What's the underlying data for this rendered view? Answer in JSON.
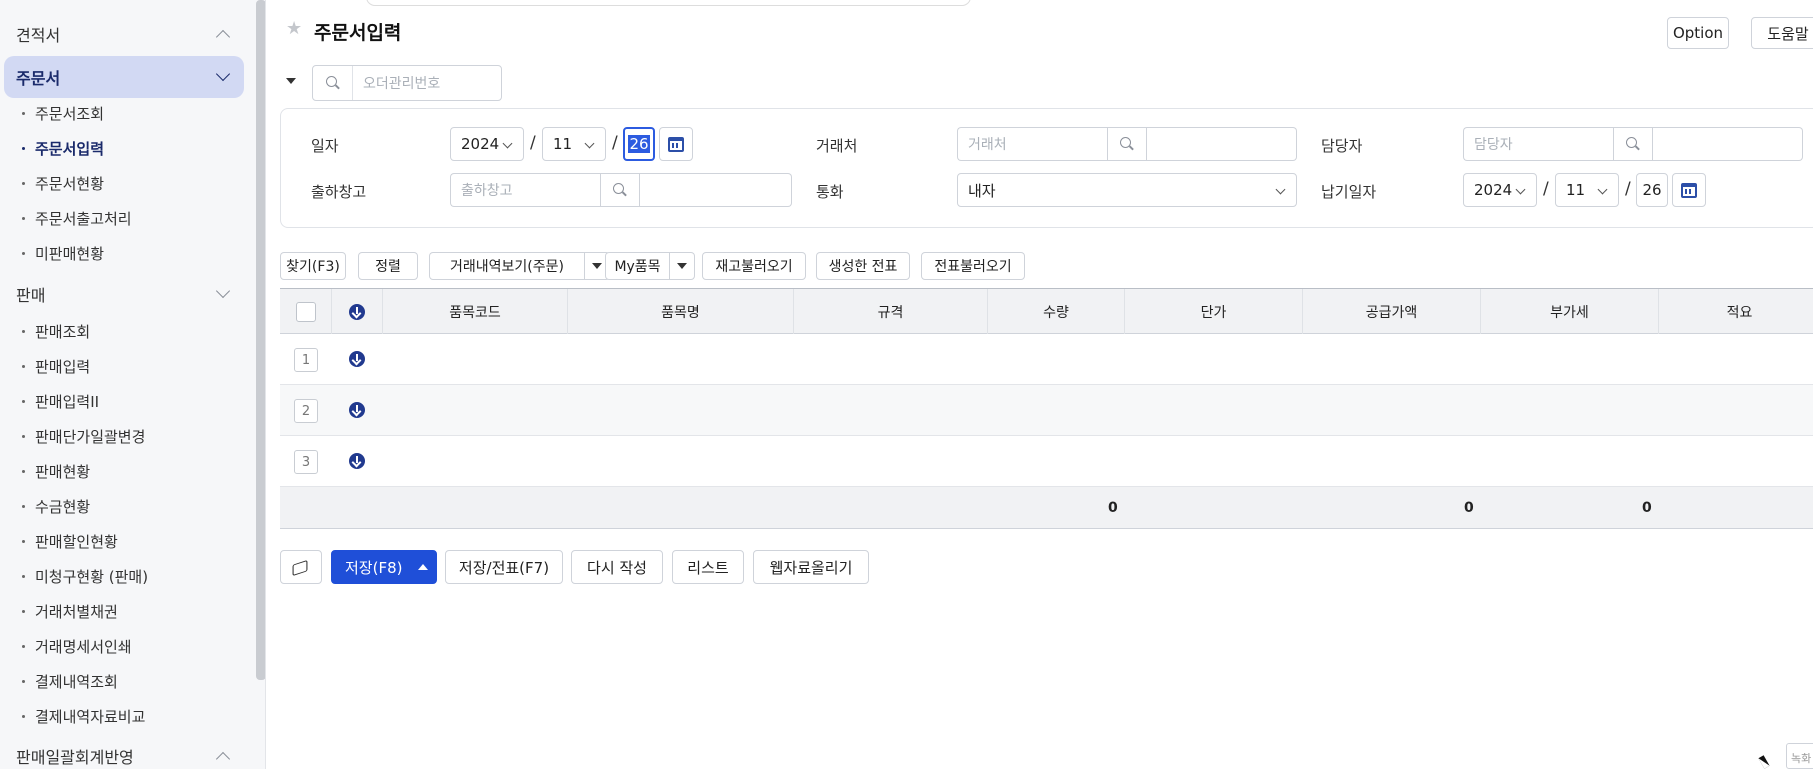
{
  "sidebar": {
    "groups": [
      {
        "label": "견적서"
      },
      {
        "label": "주문서"
      },
      {
        "label": "판매"
      },
      {
        "label": "판매일괄회계반영"
      }
    ],
    "order_items": [
      "주문서조회",
      "주문서입력",
      "주문서현황",
      "주문서출고처리",
      "미판매현황"
    ],
    "sales_items": [
      "판매조회",
      "판매입력",
      "판매입력II",
      "판매단가일괄변경",
      "판매현황",
      "수금현황",
      "판매할인현황",
      "미청구현황 (판매)",
      "거래처별채권",
      "거래명세서인쇄",
      "결제내역조회",
      "결제내역자료비교"
    ]
  },
  "header": {
    "title": "주문서입력",
    "option_label": "Option",
    "help_label": "도움말"
  },
  "search": {
    "placeholder": "오더관리번호"
  },
  "form": {
    "date_label": "일자",
    "date_year": "2024",
    "date_month": "11",
    "date_day": "26",
    "customer_label": "거래처",
    "customer_placeholder": "거래처",
    "manager_label": "담당자",
    "manager_placeholder": "담당자",
    "warehouse_label": "출하창고",
    "warehouse_placeholder": "출하창고",
    "currency_label": "통화",
    "currency_value": "내자",
    "due_label": "납기일자",
    "due_year": "2024",
    "due_month": "11",
    "due_day": "26",
    "slash": "/"
  },
  "toolbar": {
    "find": "찾기(F3)",
    "sort": "정렬",
    "history": "거래내역보기(주문)",
    "my_items": "My품목",
    "load_stock": "재고불러오기",
    "created_slip": "생성한 전표",
    "load_slip": "전표불러오기"
  },
  "grid": {
    "columns": [
      "품목코드",
      "품목명",
      "규격",
      "수량",
      "단가",
      "공급가액",
      "부가세",
      "적요"
    ],
    "rows": [
      "1",
      "2",
      "3"
    ],
    "totals": {
      "qty": "0",
      "supply": "0",
      "vat": "0"
    }
  },
  "actions": {
    "save": "저장(F8)",
    "save_slip": "저장/전표(F7)",
    "rewrite": "다시 작성",
    "list": "리스트",
    "upload": "웹자료올리기"
  },
  "corner_text": "녹화"
}
